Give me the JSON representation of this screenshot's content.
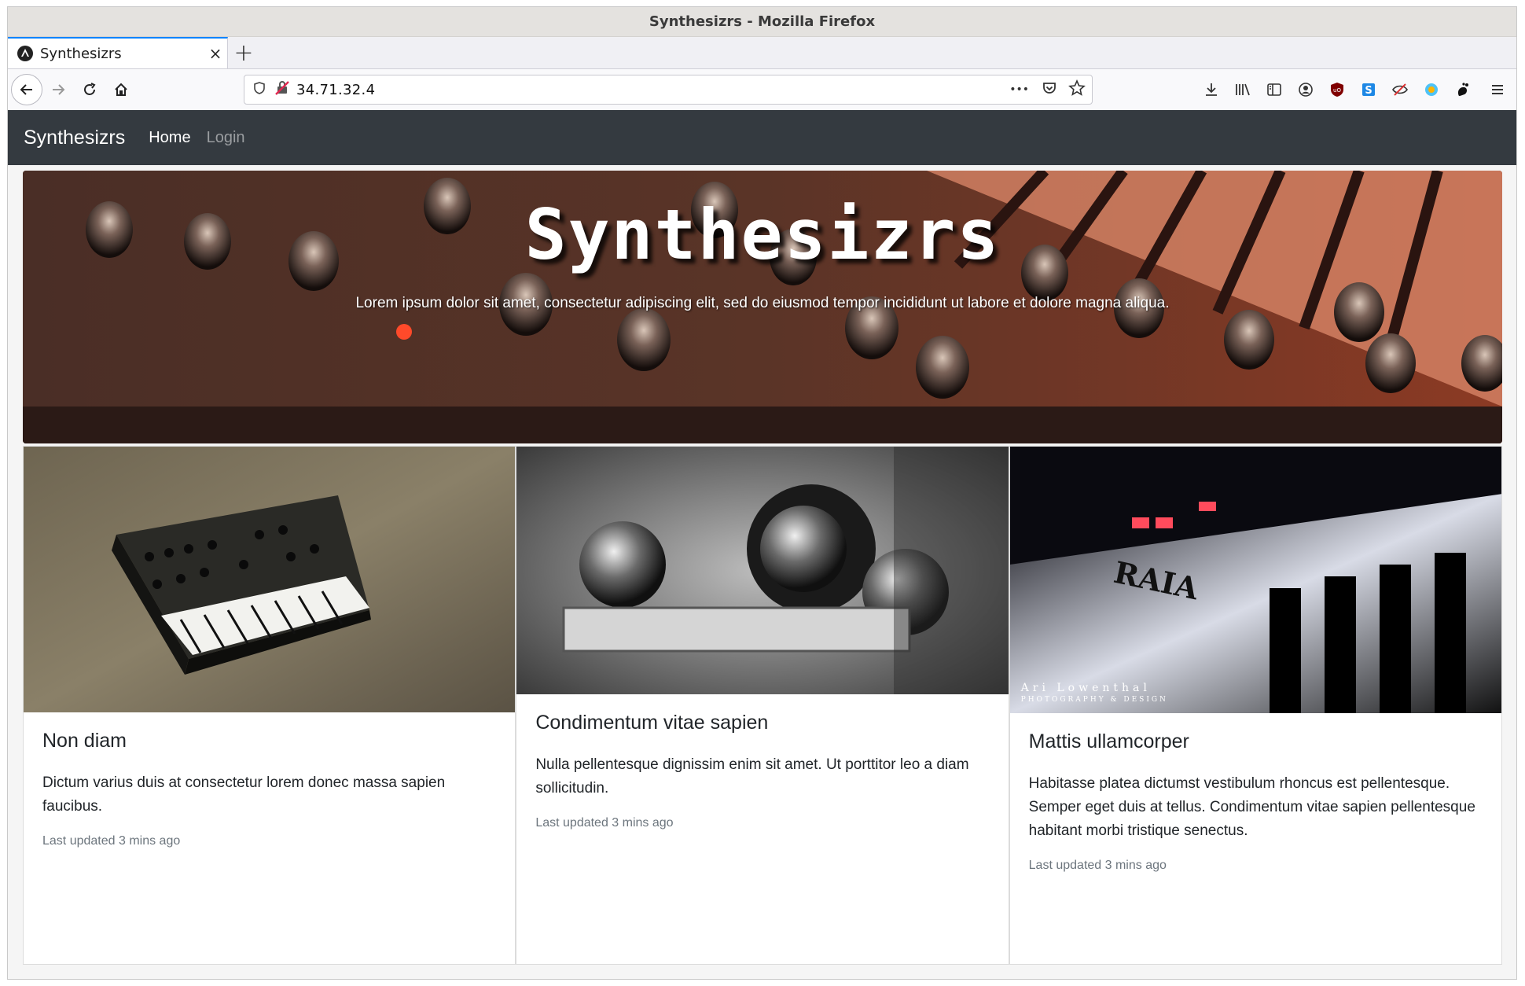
{
  "window": {
    "title": "Synthesizrs - Mozilla Firefox"
  },
  "tab": {
    "title": "Synthesizrs",
    "close_label": "×",
    "new_tab_label": "+"
  },
  "urlbar": {
    "url": "34.71.32.4",
    "more_label": "•••"
  },
  "site": {
    "brand": "Synthesizrs",
    "nav": [
      {
        "label": "Home",
        "active": true
      },
      {
        "label": "Login",
        "active": false
      }
    ]
  },
  "hero": {
    "title": "Synthesizrs",
    "subtitle": "Lorem ipsum dolor sit amet, consectetur adipiscing elit, sed do eiusmod tempor incididunt ut labore et dolore magna aliqua."
  },
  "cards": [
    {
      "title": "Non diam",
      "text": "Dictum varius duis at consectetur lorem donec massa sapien faucibus.",
      "meta": "Last updated 3 mins ago",
      "image": "korg-synth"
    },
    {
      "title": "Condimentum vitae sapien",
      "text": "Nulla pellentesque dignissim enim sit amet. Ut porttitor leo a diam sollicitudin.",
      "meta": "Last updated 3 mins ago",
      "image": "knobs-bw"
    },
    {
      "title": "Mattis ullamcorper",
      "text": "Habitasse platea dictumst vestibulum rhoncus est pellentesque. Semper eget duis at tellus. Condimentum vitae sapien pellentesque habitant morbi tristique senectus.",
      "meta": "Last updated 3 mins ago",
      "image": "roland-sh01",
      "credit_line1": "Ari Lowenthal",
      "credit_line2": "PHOTOGRAPHY & DESIGN"
    }
  ],
  "colors": {
    "site_nav_bg": "#343a40",
    "tab_accent": "#0a84ff"
  }
}
